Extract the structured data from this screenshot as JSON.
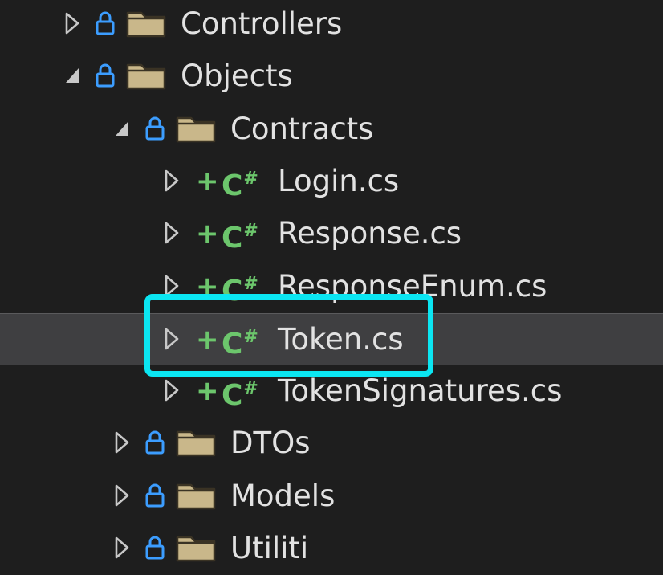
{
  "tree": {
    "items": [
      {
        "label": "Controllers",
        "kind": "folder",
        "expander": "collapsed",
        "badge": "lock",
        "indent": 0
      },
      {
        "label": "Objects",
        "kind": "folder",
        "expander": "expanded",
        "badge": "lock",
        "indent": 0
      },
      {
        "label": "Contracts",
        "kind": "folder",
        "expander": "expanded",
        "badge": "lock",
        "indent": 1
      },
      {
        "label": "Login.cs",
        "kind": "csharp",
        "expander": "collapsed",
        "badge": "plus",
        "indent": 2
      },
      {
        "label": "Response.cs",
        "kind": "csharp",
        "expander": "collapsed",
        "badge": "plus",
        "indent": 2
      },
      {
        "label": "ResponseEnum.cs",
        "kind": "csharp",
        "expander": "collapsed",
        "badge": "plus",
        "indent": 2
      },
      {
        "label": "Token.cs",
        "kind": "csharp",
        "expander": "collapsed",
        "badge": "plus",
        "indent": 2,
        "selected": true
      },
      {
        "label": "TokenSignatures.cs",
        "kind": "csharp",
        "expander": "collapsed",
        "badge": "plus",
        "indent": 2
      },
      {
        "label": "DTOs",
        "kind": "folder",
        "expander": "collapsed",
        "badge": "lock",
        "indent": 1
      },
      {
        "label": "Models",
        "kind": "folder",
        "expander": "collapsed",
        "badge": "lock",
        "indent": 1
      },
      {
        "label": "Utiliti",
        "kind": "folder",
        "expander": "collapsed",
        "badge": "lock",
        "indent": 1
      }
    ]
  },
  "icons": {
    "csharp_text": "C",
    "csharp_sharp": "#",
    "plus_text": "+"
  },
  "colors": {
    "background": "#1e1e1e",
    "selection": "#3f3f41",
    "highlight_border": "#0be6f2",
    "lock": "#3c9dff",
    "folder": "#c9b78a",
    "csharp_green": "#6cc66c",
    "expander": "#c8c8c8"
  }
}
